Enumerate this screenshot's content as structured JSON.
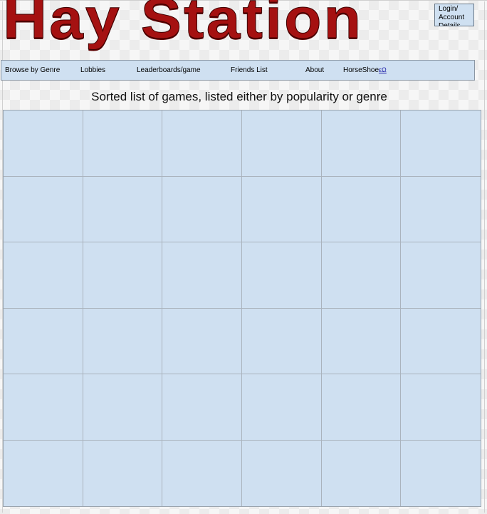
{
  "site": {
    "title": "Hay Station"
  },
  "account": {
    "login_label": "Login/ Account Details"
  },
  "nav": {
    "items": [
      {
        "label": "Browse by Genre"
      },
      {
        "label": "Lobbies"
      },
      {
        "label": "Leaderboards/game"
      },
      {
        "label": "Friends List"
      },
      {
        "label": "About"
      },
      {
        "label": "HorseShoe",
        "link_text": "εΩ"
      }
    ]
  },
  "main": {
    "subtitle": "Sorted list of games, listed either by popularity or genre",
    "grid": {
      "rows": 6,
      "columns": 6
    }
  },
  "colors": {
    "logo": "#a51111",
    "panel": "#cfe0f1",
    "border": "#8a96a3"
  }
}
